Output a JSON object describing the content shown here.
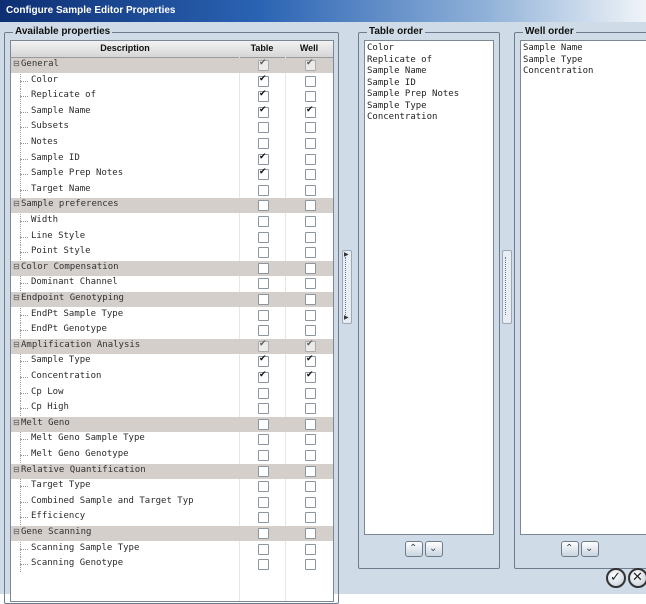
{
  "window": {
    "title": "Configure Sample Editor Properties"
  },
  "available": {
    "legend": "Available properties",
    "columns": {
      "description": "Description",
      "table": "Table",
      "well": "Well"
    },
    "rows": [
      {
        "label": "General",
        "level": 0,
        "table": true,
        "well": true,
        "dim": true
      },
      {
        "label": "Color",
        "level": 1,
        "table": true,
        "well": false
      },
      {
        "label": "Replicate of",
        "level": 1,
        "table": true,
        "well": false
      },
      {
        "label": "Sample Name",
        "level": 1,
        "table": true,
        "well": true
      },
      {
        "label": "Subsets",
        "level": 1,
        "table": false,
        "well": false
      },
      {
        "label": "Notes",
        "level": 1,
        "table": false,
        "well": false
      },
      {
        "label": "Sample ID",
        "level": 1,
        "table": true,
        "well": false
      },
      {
        "label": "Sample Prep Notes",
        "level": 1,
        "table": true,
        "well": false
      },
      {
        "label": "Target Name",
        "level": 1,
        "table": false,
        "well": false
      },
      {
        "label": "Sample preferences",
        "level": 0,
        "table": false,
        "well": false
      },
      {
        "label": "Width",
        "level": 1,
        "table": false,
        "well": false
      },
      {
        "label": "Line Style",
        "level": 1,
        "table": false,
        "well": false
      },
      {
        "label": "Point Style",
        "level": 1,
        "table": false,
        "well": false
      },
      {
        "label": "Color Compensation",
        "level": 0,
        "table": false,
        "well": false
      },
      {
        "label": "Dominant Channel",
        "level": 1,
        "table": false,
        "well": false
      },
      {
        "label": "Endpoint Genotyping",
        "level": 0,
        "table": false,
        "well": false
      },
      {
        "label": "EndPt Sample Type",
        "level": 1,
        "table": false,
        "well": false
      },
      {
        "label": "EndPt Genotype",
        "level": 1,
        "table": false,
        "well": false
      },
      {
        "label": "Amplification Analysis",
        "level": 0,
        "table": true,
        "well": true,
        "dim": true
      },
      {
        "label": "Sample Type",
        "level": 1,
        "table": true,
        "well": true
      },
      {
        "label": "Concentration",
        "level": 1,
        "table": true,
        "well": true
      },
      {
        "label": "Cp Low",
        "level": 1,
        "table": false,
        "well": false
      },
      {
        "label": "Cp High",
        "level": 1,
        "table": false,
        "well": false
      },
      {
        "label": "Melt Geno",
        "level": 0,
        "table": false,
        "well": false
      },
      {
        "label": "Melt Geno Sample Type",
        "level": 1,
        "table": false,
        "well": false
      },
      {
        "label": "Melt Geno Genotype",
        "level": 1,
        "table": false,
        "well": false
      },
      {
        "label": "Relative Quantification",
        "level": 0,
        "table": false,
        "well": false
      },
      {
        "label": "Target Type",
        "level": 1,
        "table": false,
        "well": false
      },
      {
        "label": "Combined Sample and Target Typ",
        "level": 1,
        "table": false,
        "well": false
      },
      {
        "label": "Efficiency",
        "level": 1,
        "table": false,
        "well": false
      },
      {
        "label": "Gene Scanning",
        "level": 0,
        "table": false,
        "well": false
      },
      {
        "label": "Scanning Sample Type",
        "level": 1,
        "table": false,
        "well": false
      },
      {
        "label": "Scanning Genotype",
        "level": 1,
        "table": false,
        "well": false
      }
    ]
  },
  "table_order": {
    "legend": "Table order",
    "items": [
      "Color",
      "Replicate of",
      "Sample Name",
      "Sample ID",
      "Sample Prep Notes",
      "Sample Type",
      "Concentration"
    ]
  },
  "well_order": {
    "legend": "Well order",
    "items": [
      "Sample Name",
      "Sample Type",
      "Concentration"
    ]
  },
  "icons": {
    "up": "▲-chevron-up-icon",
    "down": "chevron-down-icon",
    "ok": "checkmark-circle-icon",
    "cancel": "close-circle-icon",
    "expanded": "minus-expander-icon"
  }
}
